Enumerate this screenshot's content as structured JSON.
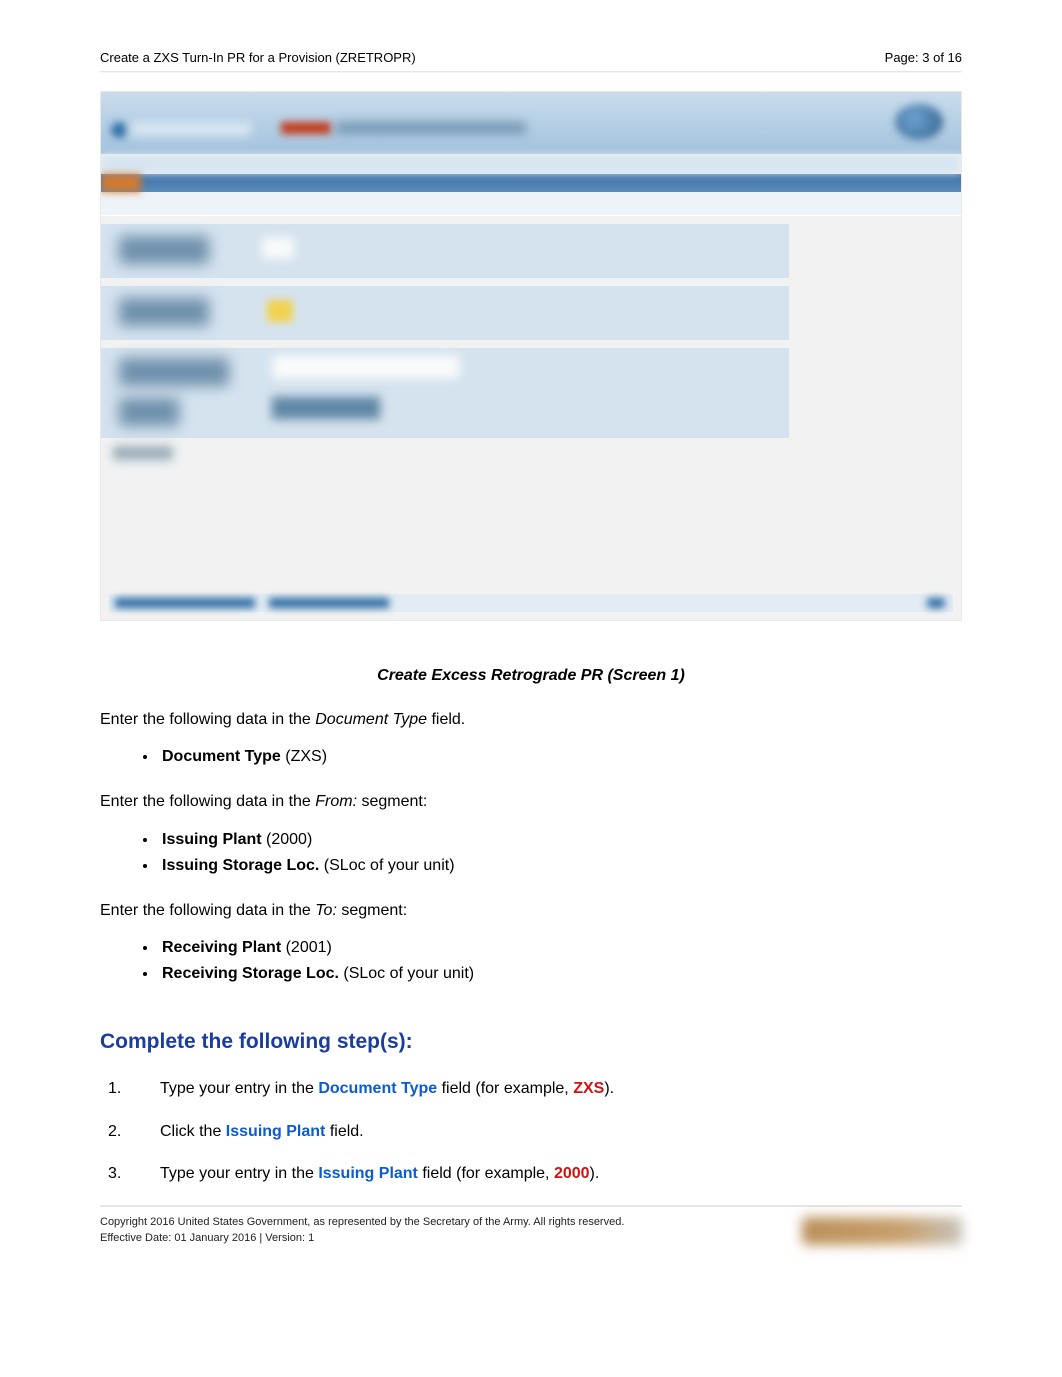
{
  "header": {
    "title": "Create a ZXS Turn-In PR for a Provision (ZRETROPR)",
    "page_label": "Page: 3 of 16"
  },
  "caption": "Create Excess Retrograde PR (Screen 1)",
  "intro1_prefix": "Enter the following data in the ",
  "intro1_field": "Document Type",
  "intro1_suffix": " field.",
  "list1": [
    {
      "label": "Document Type",
      "value": " (ZXS)"
    }
  ],
  "intro2_prefix": "Enter the following data in the ",
  "intro2_field": "From:",
  "intro2_suffix": " segment:",
  "list2": [
    {
      "label": "Issuing Plant",
      "value": " (2000)"
    },
    {
      "label": "Issuing Storage Loc.",
      "value": " (SLoc of your unit)"
    }
  ],
  "intro3_prefix": "Enter the following data in the ",
  "intro3_field": "To:",
  "intro3_suffix": " segment:",
  "list3": [
    {
      "label": "Receiving Plant",
      "value": " (2001)"
    },
    {
      "label": "Receiving Storage Loc.",
      "value": " (SLoc of your unit)"
    }
  ],
  "steps_heading": "Complete the following step(s):",
  "steps": {
    "s1_a": "Type your entry in the ",
    "s1_b": "Document Type",
    "s1_c": " field (for example, ",
    "s1_d": "ZXS",
    "s1_e": ").",
    "s2_a": "Click the ",
    "s2_b": "Issuing Plant",
    "s2_c": " field.",
    "s3_a": "Type your entry in the ",
    "s3_b": "Issuing Plant",
    "s3_c": " field (for example, ",
    "s3_d": "2000",
    "s3_e": ")."
  },
  "footer": {
    "line1": "Copyright 2016 United States Government, as represented by the Secretary of the Army. All rights reserved.",
    "line2": "Effective Date: 01 January 2016 | Version: 1"
  }
}
